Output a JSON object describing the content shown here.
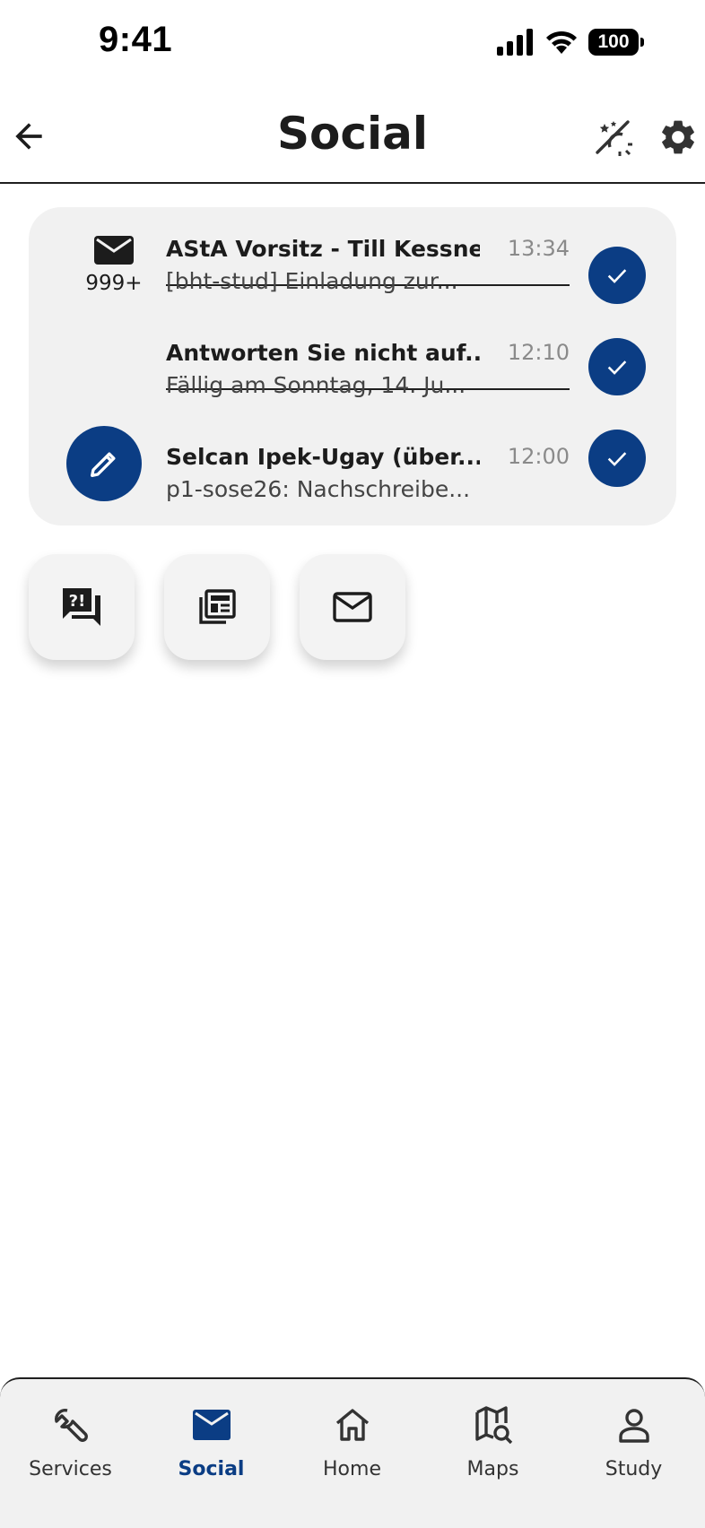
{
  "status_bar": {
    "time": "9:41",
    "battery": "100"
  },
  "header": {
    "title": "Social"
  },
  "mail": {
    "unread_count": "999+",
    "messages": [
      {
        "sender": "AStA Vorsitz - Till Kessner",
        "time": "13:34",
        "preview": "[bht-stud] Einladung zur..."
      },
      {
        "sender": "Antworten Sie nicht auf...",
        "time": "12:10",
        "preview": "Fällig am Sonntag, 14. Ju..."
      },
      {
        "sender": "Selcan Ipek-Ugay (über...",
        "time": "12:00",
        "preview": "p1-sose26: Nachschreibe..."
      }
    ]
  },
  "quick_actions": [
    {
      "icon": "feedback-icon"
    },
    {
      "icon": "news-icon"
    },
    {
      "icon": "mail-icon"
    }
  ],
  "nav": {
    "items": [
      {
        "label": "Services",
        "icon": "wrench-icon"
      },
      {
        "label": "Social",
        "icon": "mail-icon",
        "active": true
      },
      {
        "label": "Home",
        "icon": "home-icon"
      },
      {
        "label": "Maps",
        "icon": "map-search-icon"
      },
      {
        "label": "Study",
        "icon": "person-icon"
      }
    ]
  },
  "colors": {
    "accent": "#0b3d84",
    "card": "#f1f1f1",
    "text": "#1c1c1c",
    "muted": "#8a8a8a"
  }
}
